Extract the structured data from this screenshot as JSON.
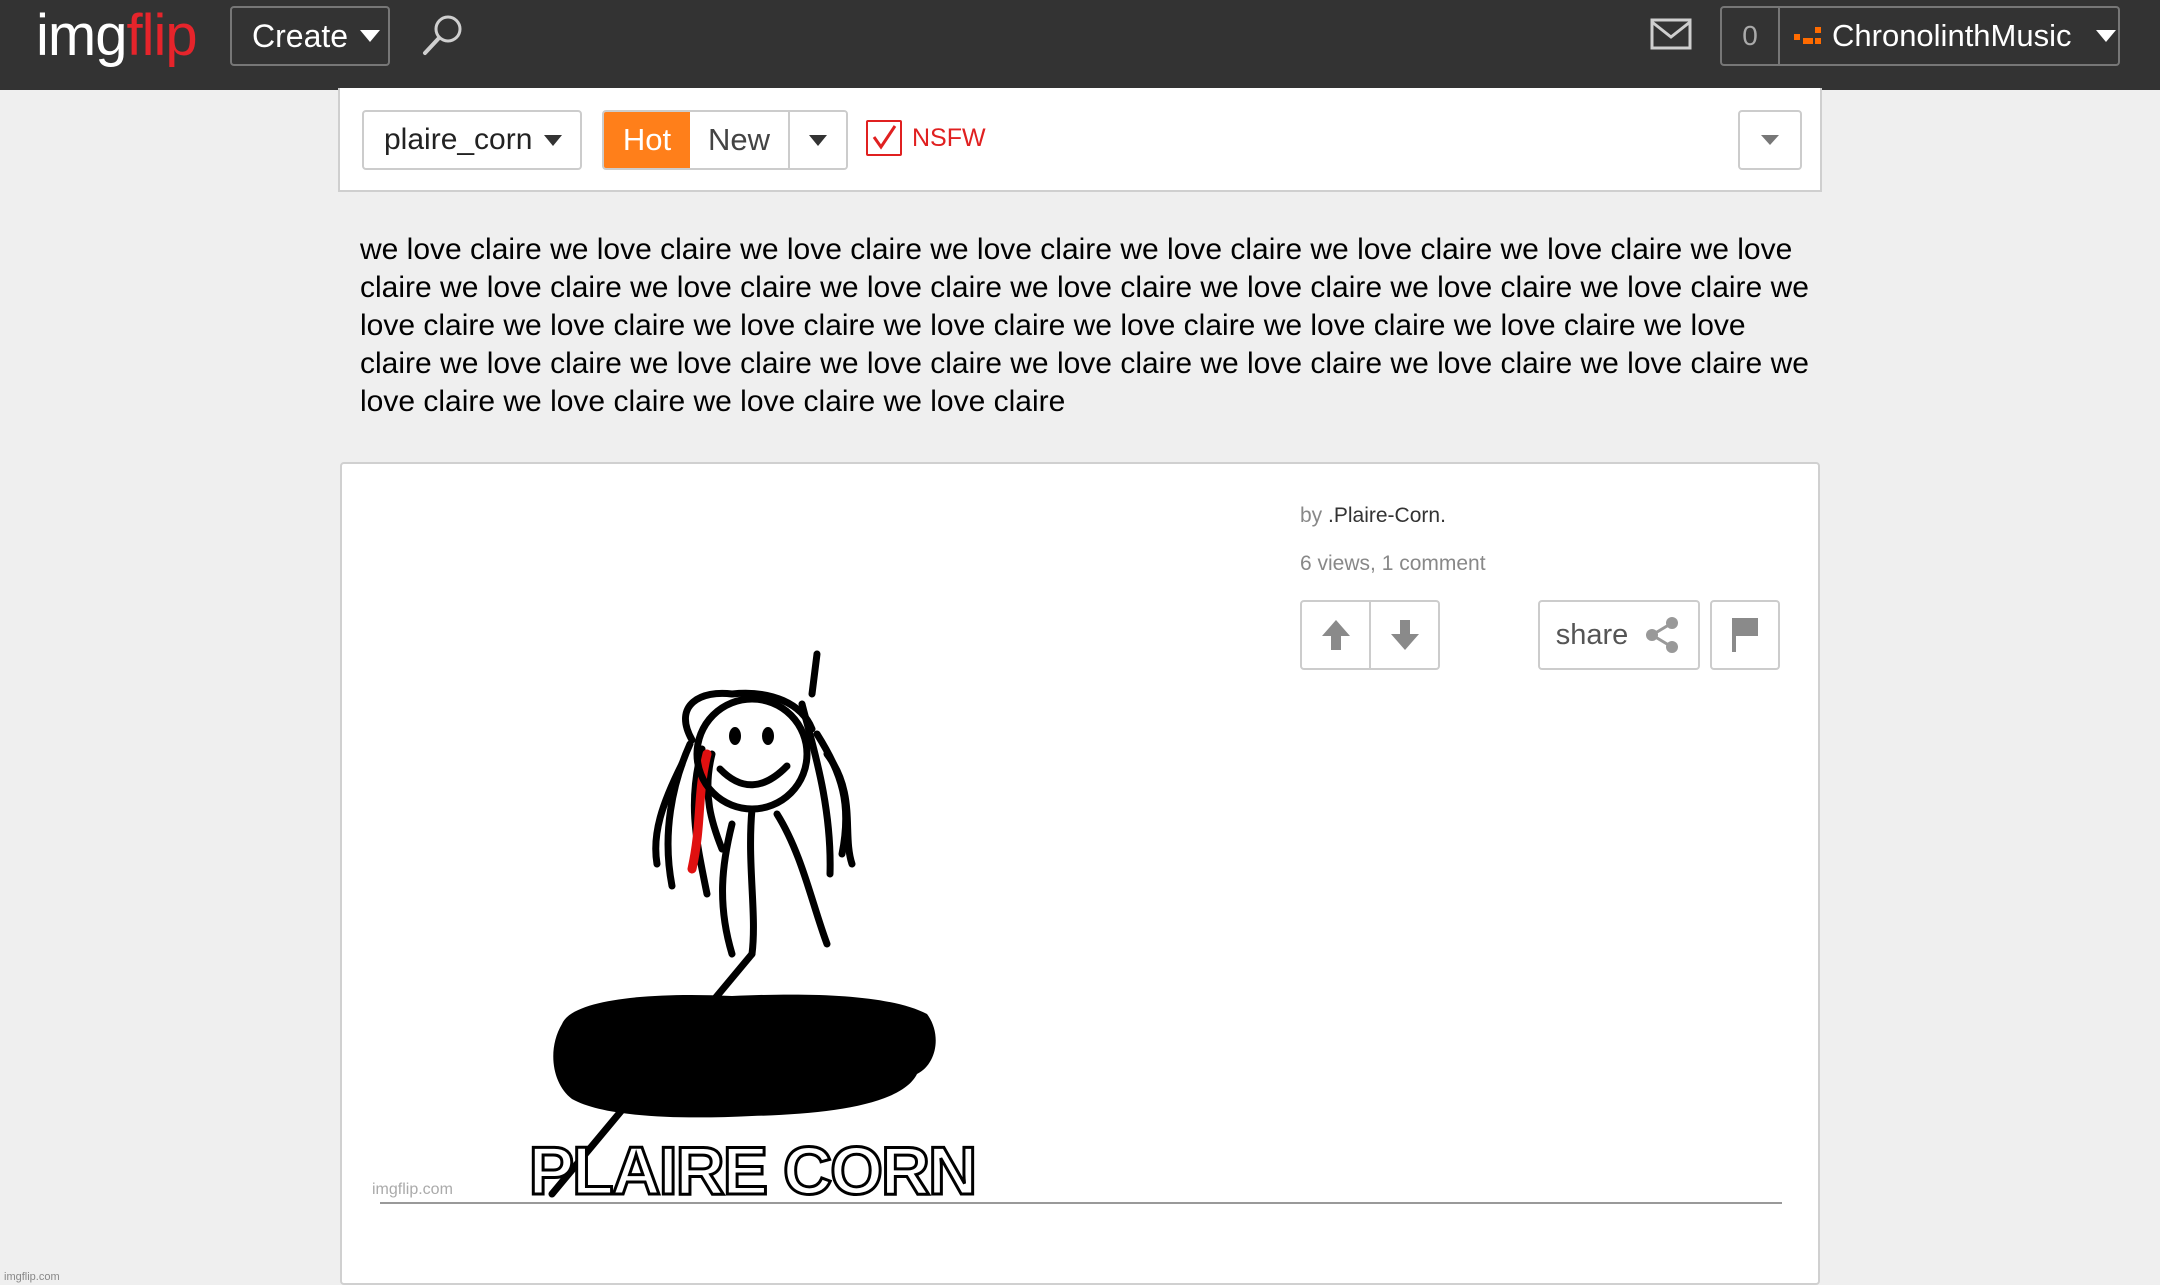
{
  "header": {
    "logo_img": "img",
    "logo_flip": "flip",
    "create_label": "Create",
    "points": "0",
    "username": "ChronolinthMusic",
    "icons": [
      "search-icon",
      "mail-icon",
      "chevron-down-icon"
    ],
    "colors": {
      "bar": "#333333",
      "logo_accent": "#e6242b",
      "user_icon": "#ff6b00"
    }
  },
  "filters": {
    "stream": "plaire_corn",
    "sort_hot": "Hot",
    "sort_new": "New",
    "nsfw_label": "NSFW",
    "nsfw_checked": true,
    "colors": {
      "hot": "#ff7f1a",
      "nsfw": "#e02020"
    }
  },
  "description": "we love claire we love claire we love claire we love claire we love claire we love claire we love claire we love claire we love claire we love claire we love claire we love claire we love claire we love claire we love claire we love claire we love claire we love claire we love claire we love claire we love claire we love claire we love claire we love claire we love claire we love claire we love claire we love claire we love claire we love claire we love claire we love claire we love claire we love claire",
  "post": {
    "by_prefix": "by",
    "author": ".Plaire-Corn.",
    "stats": "6 views, 1 comment",
    "share_label": "share",
    "image": {
      "watermark": "imgflip.com",
      "caption": "PLAIRE CORN"
    }
  },
  "footer": {
    "watermark": "imgflip.com"
  }
}
